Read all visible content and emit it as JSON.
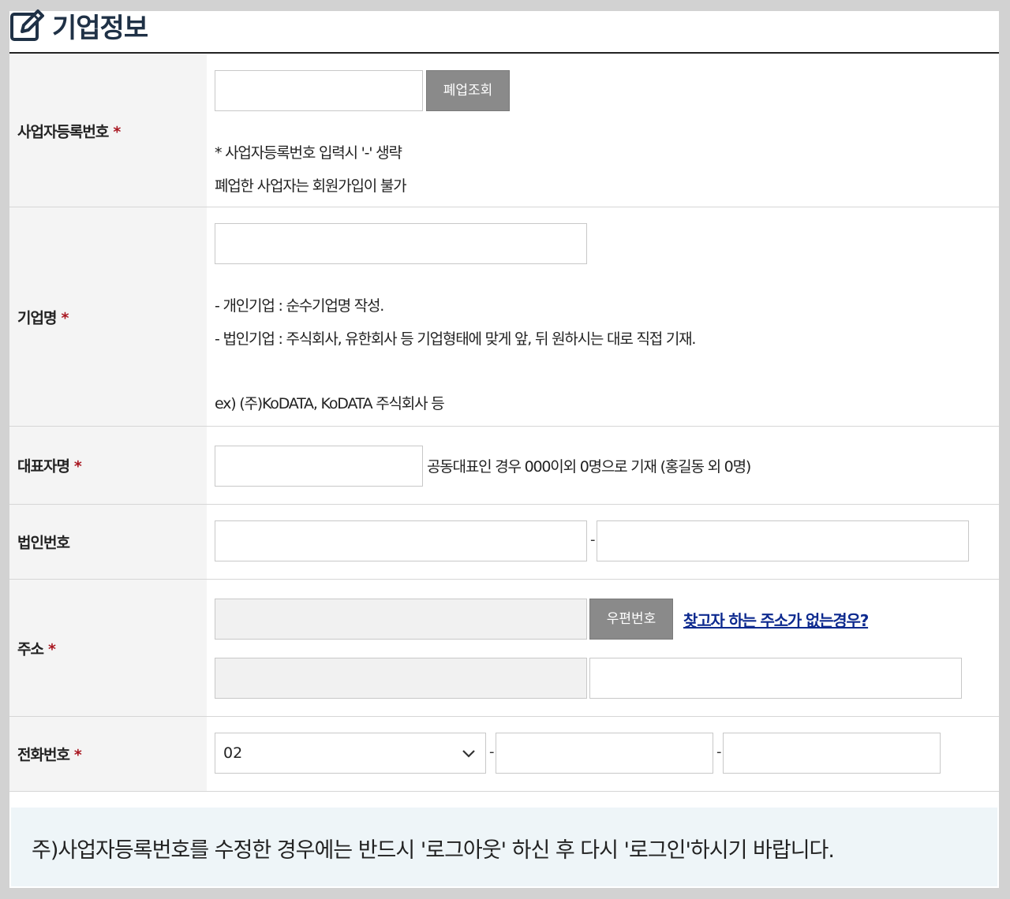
{
  "section": {
    "title": "기업정보",
    "icon": "edit-icon"
  },
  "fields": {
    "biz_reg_no": {
      "label": "사업자등록번호",
      "required_mark": "*",
      "value": "",
      "check_button": "폐업조회",
      "note1": "* 사업자등록번호 입력시 '-' 생략",
      "note2": "폐업한 사업자는 회원가입이 불가"
    },
    "company_name": {
      "label": "기업명",
      "required_mark": "*",
      "value": "",
      "note1": "- 개인기업 : 순수기업명 작성.",
      "note2": "- 법인기업 : 주식회사, 유한회사 등 기업형태에 맞게 앞, 뒤 원하시는 대로 직접 기재.",
      "note3": "ex) (주)KoDATA, KoDATA 주식회사 등"
    },
    "ceo_name": {
      "label": "대표자명",
      "required_mark": "*",
      "value": "",
      "note": "공동대표인 경우 000이외 0명으로 기재 (홍길동 외 0명)"
    },
    "corp_no": {
      "label": "법인번호",
      "separator": "-",
      "part1": "",
      "part2": ""
    },
    "address": {
      "label": "주소",
      "required_mark": "*",
      "postcode": "",
      "postcode_button": "우편번호",
      "help_link": "찾고자 하는 주소가 없는경우?",
      "address1": "",
      "address2": ""
    },
    "phone": {
      "label": "전화번호",
      "required_mark": "*",
      "area_code": "02",
      "separator": "-",
      "part2": "",
      "part3": ""
    }
  },
  "footer_notice": "주)사업자등록번호를 수정한 경우에는 반드시 '로그아웃' 하신 후 다시 '로그인'하시기 바랍니다.",
  "colors": {
    "title": "#1f3146",
    "required": "#a8151f",
    "button": "#8a8a8a",
    "link": "#0d2a8f",
    "notice_bg": "#eef5f8"
  }
}
